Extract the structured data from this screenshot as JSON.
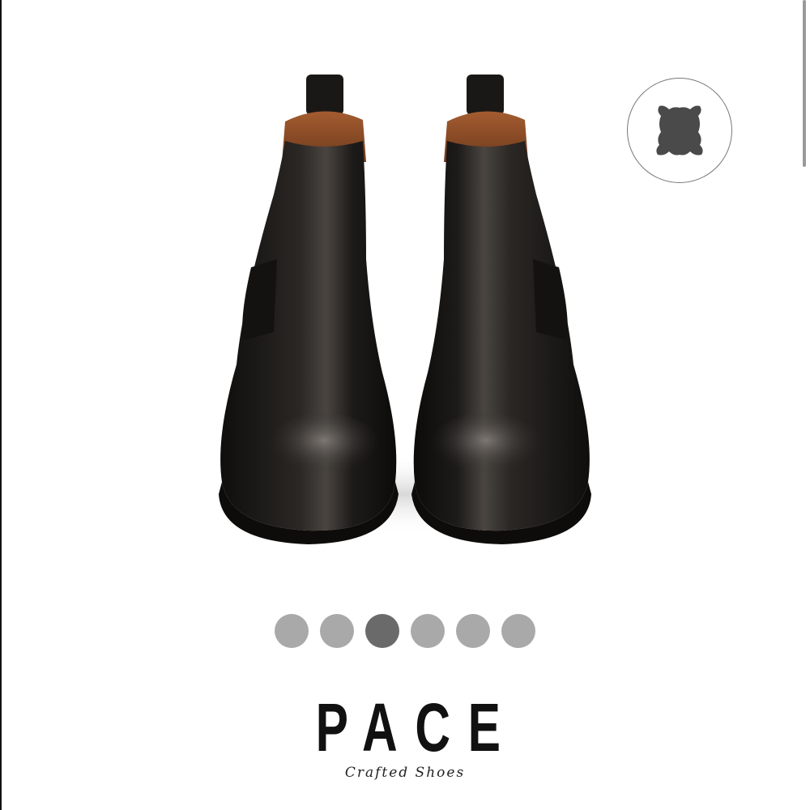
{
  "product": {
    "image_alt": "Black leather Chelsea boots, front view",
    "colors": {
      "leather": "#1c1a18",
      "lining": "#8a4a26",
      "sole": "#0d0c0b"
    }
  },
  "badge": {
    "icon": "leather-hide-icon",
    "color": "#4a4a4a"
  },
  "carousel": {
    "dots": [
      {
        "color": "#a9a9a9"
      },
      {
        "color": "#a9a9a9"
      },
      {
        "color": "#6a6a6a"
      },
      {
        "color": "#a9a9a9"
      },
      {
        "color": "#a9a9a9"
      },
      {
        "color": "#a9a9a9"
      }
    ],
    "active_index": 2
  },
  "brand": {
    "name": "PACE",
    "tagline": "Crafted Shoes"
  }
}
